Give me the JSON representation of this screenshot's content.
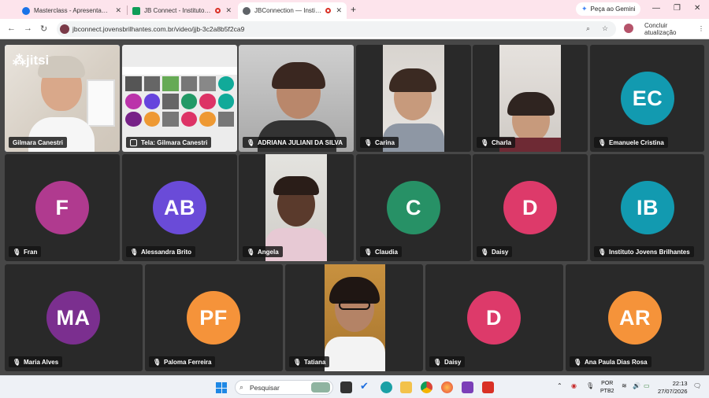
{
  "tabs": [
    {
      "title": "Masterclass - Apresentação",
      "favicon_color": "#1a73e8"
    },
    {
      "title": "JB Connect - Instituto Jovens Brilhantes",
      "favicon_color": "#0f9d58"
    },
    {
      "title": "JBConnection — Instituto Jovens Brilhantes",
      "favicon_color": "#5f6368"
    }
  ],
  "gemini_label": "Peça ao Gemini",
  "url": "jbconnect.jovensbrilhantes.com.br/video/jjb-3c2a8b5f2ca9",
  "update_label": "Concluir atualização",
  "jitsi_label": "jitsi",
  "participants": [
    {
      "name": "Gilmara Canestri",
      "type": "video",
      "speaking": true
    },
    {
      "name": "Tela: Gilmara Canestri",
      "type": "screen"
    },
    {
      "name": "ADRIANA JULIANI DA SILVA",
      "type": "video"
    },
    {
      "name": "Carina",
      "type": "video"
    },
    {
      "name": "Charla",
      "type": "video"
    },
    {
      "name": "Emanuele Cristina",
      "type": "avatar",
      "initials": "EC",
      "color": "#129ab0"
    },
    {
      "name": "Fran",
      "type": "avatar",
      "initials": "F",
      "color": "#b03a8f"
    },
    {
      "name": "Alessandra Brito",
      "type": "avatar",
      "initials": "AB",
      "color": "#6a4bd8"
    },
    {
      "name": "Angela",
      "type": "video"
    },
    {
      "name": "Claudia",
      "type": "avatar",
      "initials": "C",
      "color": "#279166"
    },
    {
      "name": "Daisy",
      "type": "avatar",
      "initials": "D",
      "color": "#dd3a6a"
    },
    {
      "name": "Instituto Jovens Brilhantes",
      "type": "avatar",
      "initials": "IB",
      "color": "#129ab0"
    },
    {
      "name": "Maria Alves",
      "type": "avatar",
      "initials": "MA",
      "color": "#7b2f8f"
    },
    {
      "name": "Paloma Ferreira",
      "type": "avatar",
      "initials": "PF",
      "color": "#f5933a"
    },
    {
      "name": "Tatiana",
      "type": "video"
    },
    {
      "name": "Daisy",
      "type": "avatar",
      "initials": "D",
      "color": "#dd3a6a"
    },
    {
      "name": "Ana Paula Dias Rosa",
      "type": "avatar",
      "initials": "AR",
      "color": "#f5933a"
    }
  ],
  "taskbar": {
    "search_placeholder": "Pesquisar",
    "lang_line1": "POR",
    "lang_line2": "PTB2",
    "time": "22:13",
    "date": "27/07/2026"
  }
}
